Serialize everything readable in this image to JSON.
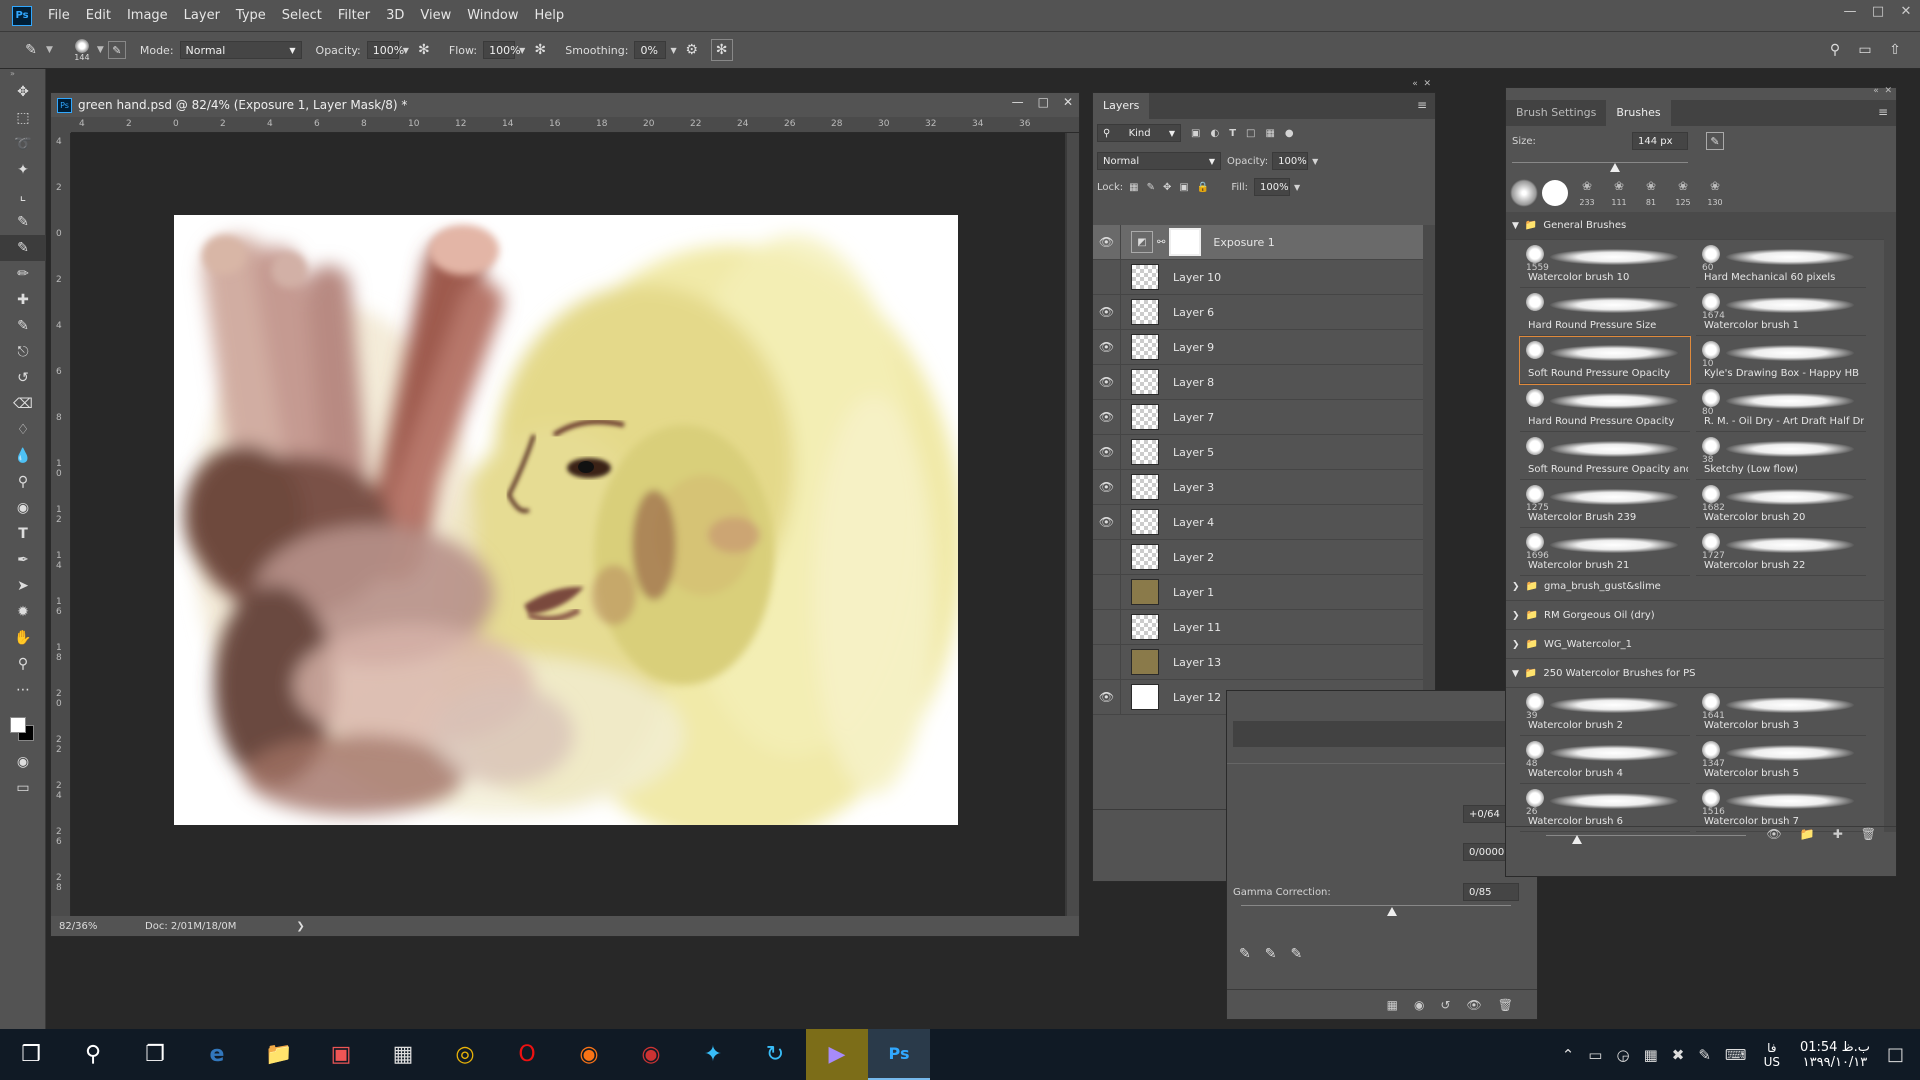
{
  "app": {
    "logo": "Ps"
  },
  "menubar": {
    "items": [
      "File",
      "Edit",
      "Image",
      "Layer",
      "Type",
      "Select",
      "Filter",
      "3D",
      "View",
      "Window",
      "Help"
    ]
  },
  "options_bar": {
    "brush_size": "144",
    "mode_label": "Mode:",
    "mode_value": "Normal",
    "opacity_label": "Opacity:",
    "opacity_value": "100%",
    "flow_label": "Flow:",
    "flow_value": "100%",
    "smoothing_label": "Smoothing:",
    "smoothing_value": "0%"
  },
  "document": {
    "title": "green hand.psd @ 82/4% (Exposure 1, Layer Mask/8) *",
    "zoom": "82/36%",
    "doc_size": "Doc: 2/01M/18/0M",
    "ruler_h": [
      "4",
      "2",
      "0",
      "2",
      "4",
      "6",
      "8",
      "10",
      "12",
      "14",
      "16",
      "18",
      "20",
      "22",
      "24",
      "26",
      "28",
      "30",
      "32",
      "34",
      "36"
    ],
    "ruler_v": [
      "4",
      "2",
      "0",
      "2",
      "4",
      "6",
      "8",
      "1 0",
      "1 2",
      "1 4",
      "1 6",
      "1 8",
      "2 0",
      "2 2",
      "2 4",
      "2 6",
      "2 8"
    ]
  },
  "layers_panel": {
    "tab": "Layers",
    "kind_filter": "Kind",
    "blend_mode": "Normal",
    "opacity_label": "Opacity:",
    "opacity_value": "100%",
    "lock_label": "Lock:",
    "fill_label": "Fill:",
    "fill_value": "100%",
    "layers": [
      {
        "name": "Exposure 1",
        "visible": true,
        "selected": true
      },
      {
        "name": "Layer 10",
        "visible": false
      },
      {
        "name": "Layer 6",
        "visible": true
      },
      {
        "name": "Layer 9",
        "visible": true
      },
      {
        "name": "Layer 8",
        "visible": true
      },
      {
        "name": "Layer 7",
        "visible": true
      },
      {
        "name": "Layer 5",
        "visible": true
      },
      {
        "name": "Layer 3",
        "visible": true
      },
      {
        "name": "Layer 4",
        "visible": true
      },
      {
        "name": "Layer 2",
        "visible": false
      },
      {
        "name": "Layer 1",
        "visible": false
      },
      {
        "name": "Layer 11",
        "visible": false
      },
      {
        "name": "Layer 13",
        "visible": false
      },
      {
        "name": "Layer 12",
        "visible": true
      }
    ]
  },
  "brushes_panel": {
    "tabs": [
      "Brush Settings",
      "Brushes"
    ],
    "size_label": "Size:",
    "size_value": "144 px",
    "presets": [
      "233",
      "111",
      "81",
      "125",
      "130"
    ],
    "groups": {
      "general": "General Brushes",
      "gma": "gma_brush_gust&slime",
      "rm": "RM Gorgeous Oil (dry)",
      "wg": "WG_Watercolor_1",
      "wc250": "250 Watercolor Brushes for PS"
    },
    "general_brushes": [
      {
        "num": "1559",
        "name": "Watercolor brush 10"
      },
      {
        "num": "60",
        "name": "Hard Mechanical 60 pixels"
      },
      {
        "num": "",
        "name": "Hard Round Pressure Size"
      },
      {
        "num": "1674",
        "name": "Watercolor brush 1"
      },
      {
        "num": "",
        "name": "Soft Round Pressure Opacity",
        "selected": true
      },
      {
        "num": "10",
        "name": "Kyle's Drawing Box - Happy HB"
      },
      {
        "num": "",
        "name": "Hard Round Pressure Opacity"
      },
      {
        "num": "80",
        "name": "R. M. - Oil Dry - Art Draft Half Dr..."
      },
      {
        "num": "",
        "name": "Soft Round Pressure Opacity and..."
      },
      {
        "num": "38",
        "name": "Sketchy (Low flow)"
      },
      {
        "num": "1275",
        "name": "Watercolor Brush 239"
      },
      {
        "num": "1682",
        "name": "Watercolor brush 20"
      },
      {
        "num": "1696",
        "name": "Watercolor brush 21"
      },
      {
        "num": "1727",
        "name": "Watercolor brush 22"
      }
    ],
    "wc_brushes": [
      {
        "num": "39",
        "name": "Watercolor brush 2"
      },
      {
        "num": "1641",
        "name": "Watercolor brush 3"
      },
      {
        "num": "48",
        "name": "Watercolor brush 4"
      },
      {
        "num": "1347",
        "name": "Watercolor brush 5"
      },
      {
        "num": "26",
        "name": "Watercolor brush 6"
      },
      {
        "num": "1516",
        "name": "Watercolor brush 7"
      }
    ]
  },
  "levels_panel": {
    "exposure": "+0/64",
    "offset": "0/0000",
    "gamma_label": "Gamma Correction:",
    "gamma": "0/85"
  },
  "taskbar": {
    "time": "01:54 ب.ظ",
    "date": "۱۳۹۹/۱۰/۱۳",
    "lang": "فا",
    "lang2": "US"
  },
  "colors": {
    "ui_dark": "#282828",
    "ui_panel": "#535353",
    "accent_blue": "#31a8ff",
    "selected_orange": "#e08a3c"
  }
}
